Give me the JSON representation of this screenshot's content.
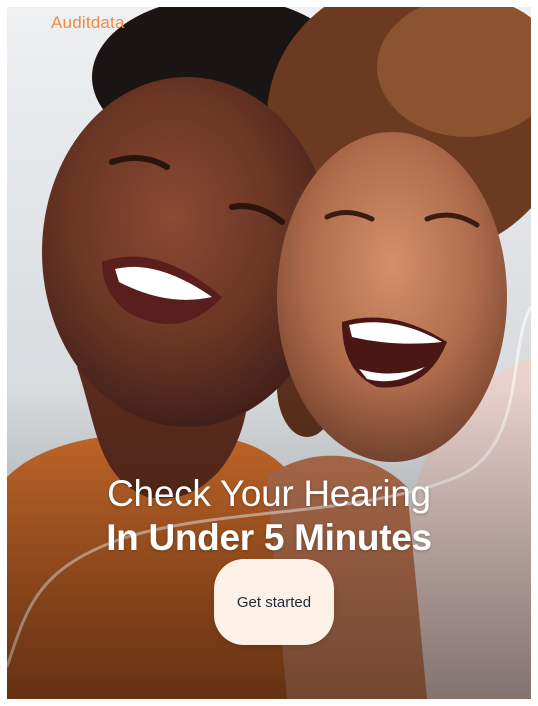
{
  "brand": {
    "name": "Auditdata",
    "color": "#f28a44"
  },
  "hero": {
    "image_description_icon": "two-smiling-women-photo",
    "headline_line1": "Check Your Hearing",
    "headline_line2": "In Under 5 Minutes"
  },
  "cta": {
    "label": "Get started",
    "background": "#fdf0e6"
  }
}
